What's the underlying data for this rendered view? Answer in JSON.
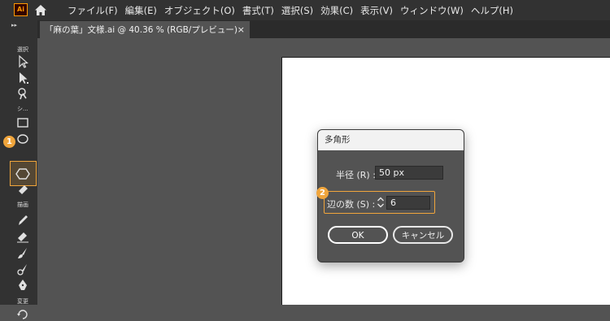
{
  "app": {
    "logo_text": "Ai"
  },
  "menu": [
    "ファイル(F)",
    "編集(E)",
    "オブジェクト(O)",
    "書式(T)",
    "選択(S)",
    "効果(C)",
    "表示(V)",
    "ウィンドウ(W)",
    "ヘルプ(H)"
  ],
  "toolbar": {
    "collapse_glyph": "▸▸",
    "group_labels": {
      "select": "選択",
      "shape": "シ...",
      "draw": "描画",
      "modify": "変更"
    }
  },
  "tab": {
    "title": "「麻の葉」文様.ai @ 40.36 % (RGB/プレビュー)",
    "close_glyph": "×"
  },
  "steps": {
    "step1": "1",
    "step2": "2"
  },
  "dialog": {
    "title": "多角形",
    "radius_label": "半径 (R) :",
    "radius_value": "50 px",
    "sides_label": "辺の数 (S) :",
    "sides_value": "6",
    "ok_label": "OK",
    "cancel_label": "キャンセル"
  },
  "colors": {
    "accent": "#f0a53c",
    "chrome": "#323232",
    "canvas": "#535353",
    "artboard": "#ffffff"
  }
}
